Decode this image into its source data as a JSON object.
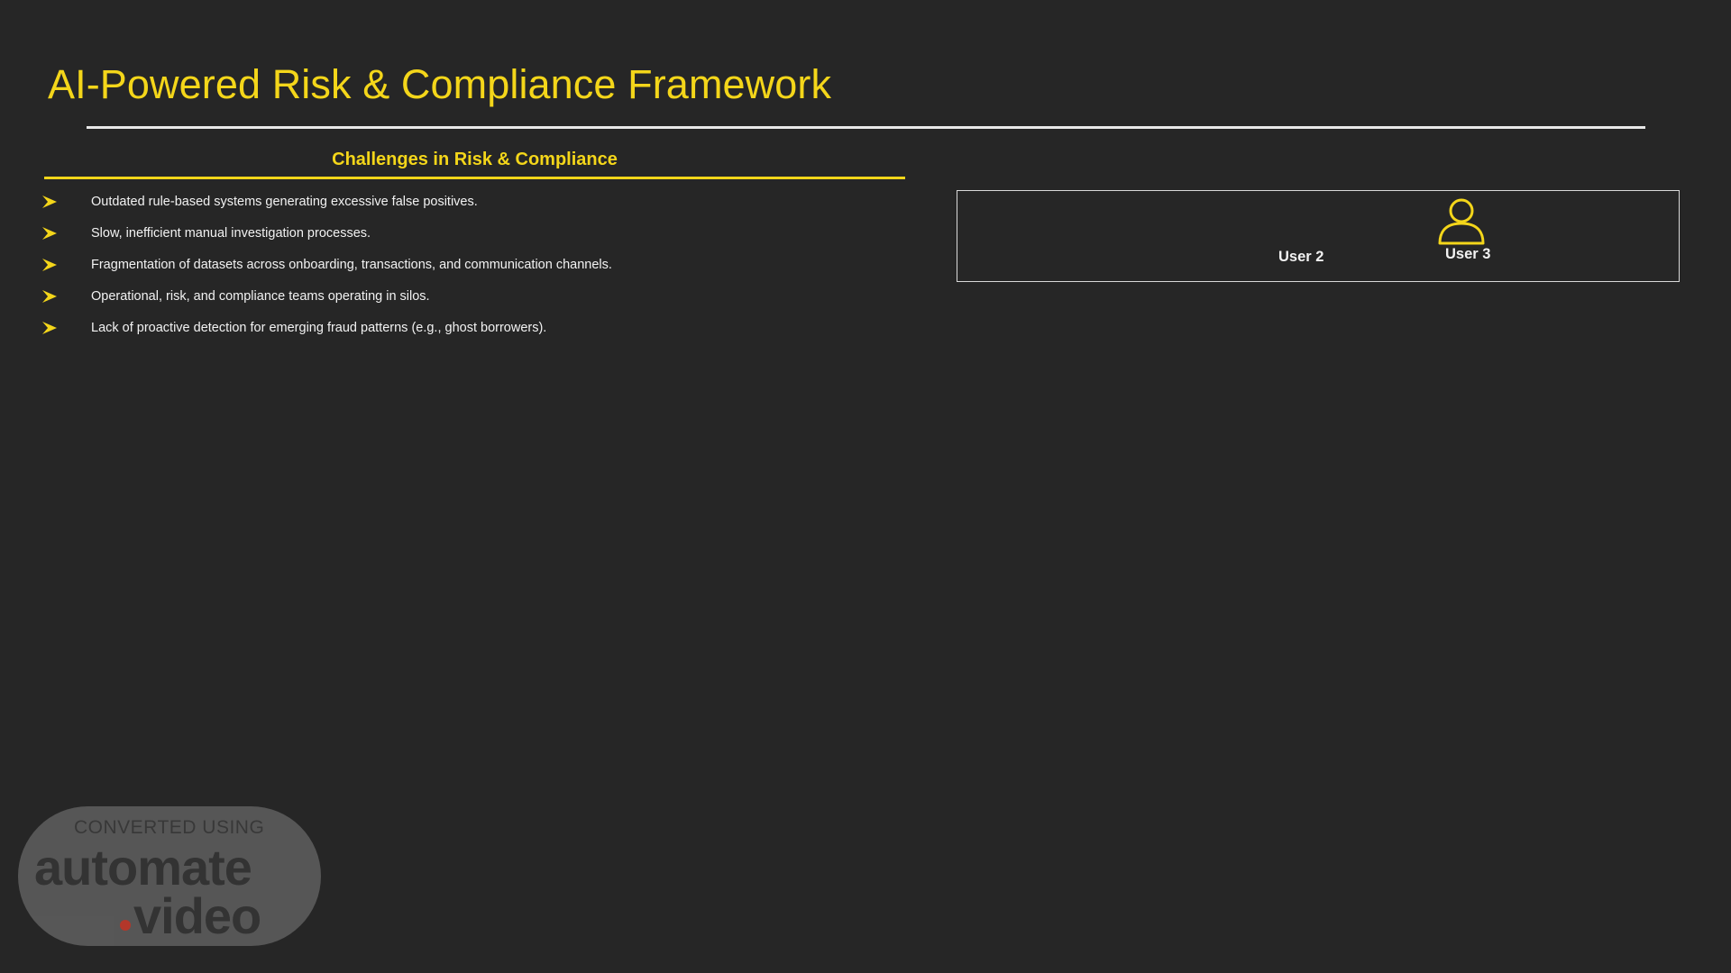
{
  "slide": {
    "title": "AI-Powered Risk & Compliance Framework"
  },
  "challenges": {
    "heading": "Challenges in Risk & Compliance",
    "items": [
      "Outdated rule-based systems generating excessive false positives.",
      "Slow, inefficient manual investigation processes.",
      "Fragmentation of datasets across onboarding, transactions, and communication channels.",
      "Operational, risk, and compliance teams operating in silos.",
      "Lack of proactive detection for emerging fraud patterns (e.g., ghost borrowers)."
    ]
  },
  "users": {
    "user2_label": "User 2",
    "user3_label": "User 3",
    "icon": "user-icon"
  },
  "watermark": {
    "line1": "CONVERTED USING",
    "word1": "automate",
    "word2": "video"
  },
  "colors": {
    "background": "#262626",
    "accent": "#f4d61a",
    "text": "#f2f2f2"
  }
}
